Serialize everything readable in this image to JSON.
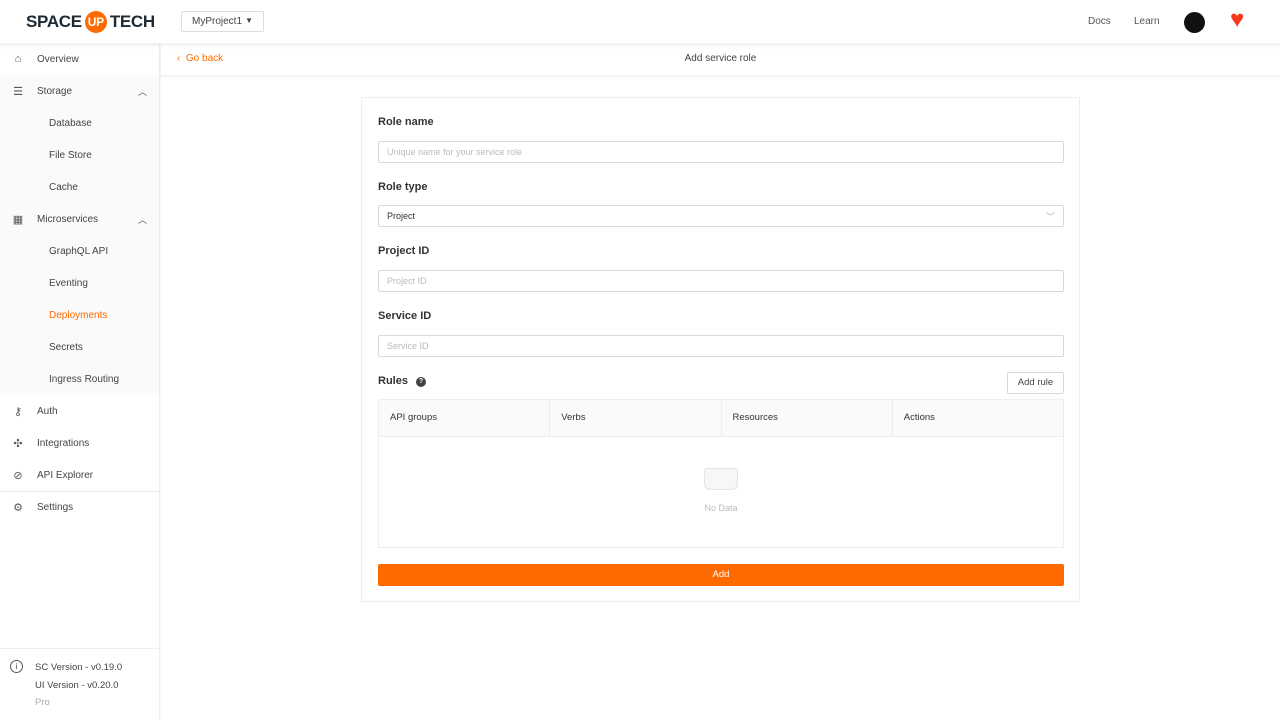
{
  "header": {
    "logo_left": "SPACE",
    "logo_mid": "UP",
    "logo_right": "TECH",
    "project": "MyProject1",
    "docs": "Docs",
    "learn": "Learn"
  },
  "sidebar": {
    "items": [
      {
        "label": "Overview"
      },
      {
        "label": "Storage"
      },
      {
        "label": "Database"
      },
      {
        "label": "File Store"
      },
      {
        "label": "Cache"
      },
      {
        "label": "Microservices"
      },
      {
        "label": "GraphQL API"
      },
      {
        "label": "Eventing"
      },
      {
        "label": "Deployments"
      },
      {
        "label": "Secrets"
      },
      {
        "label": "Ingress Routing"
      },
      {
        "label": "Auth"
      },
      {
        "label": "Integrations"
      },
      {
        "label": "API Explorer"
      },
      {
        "label": "Settings"
      }
    ],
    "active": "Deployments",
    "footer": {
      "sc_version": "SC Version - v0.19.0",
      "ui_version": "UI Version - v0.20.0",
      "edition": "Pro"
    }
  },
  "subheader": {
    "back": "Go back",
    "title": "Add service role"
  },
  "form": {
    "role_name": {
      "label": "Role name",
      "placeholder": "Unique name for your service role"
    },
    "role_type": {
      "label": "Role type",
      "value": "Project"
    },
    "project_id": {
      "label": "Project ID",
      "placeholder": "Project ID"
    },
    "service_id": {
      "label": "Service ID",
      "placeholder": "Service ID"
    },
    "rules": {
      "label": "Rules",
      "add_rule": "Add rule",
      "columns": [
        "API groups",
        "Verbs",
        "Resources",
        "Actions"
      ],
      "empty": "No Data"
    },
    "submit": "Add"
  },
  "colors": {
    "accent": "#ff6a00"
  }
}
